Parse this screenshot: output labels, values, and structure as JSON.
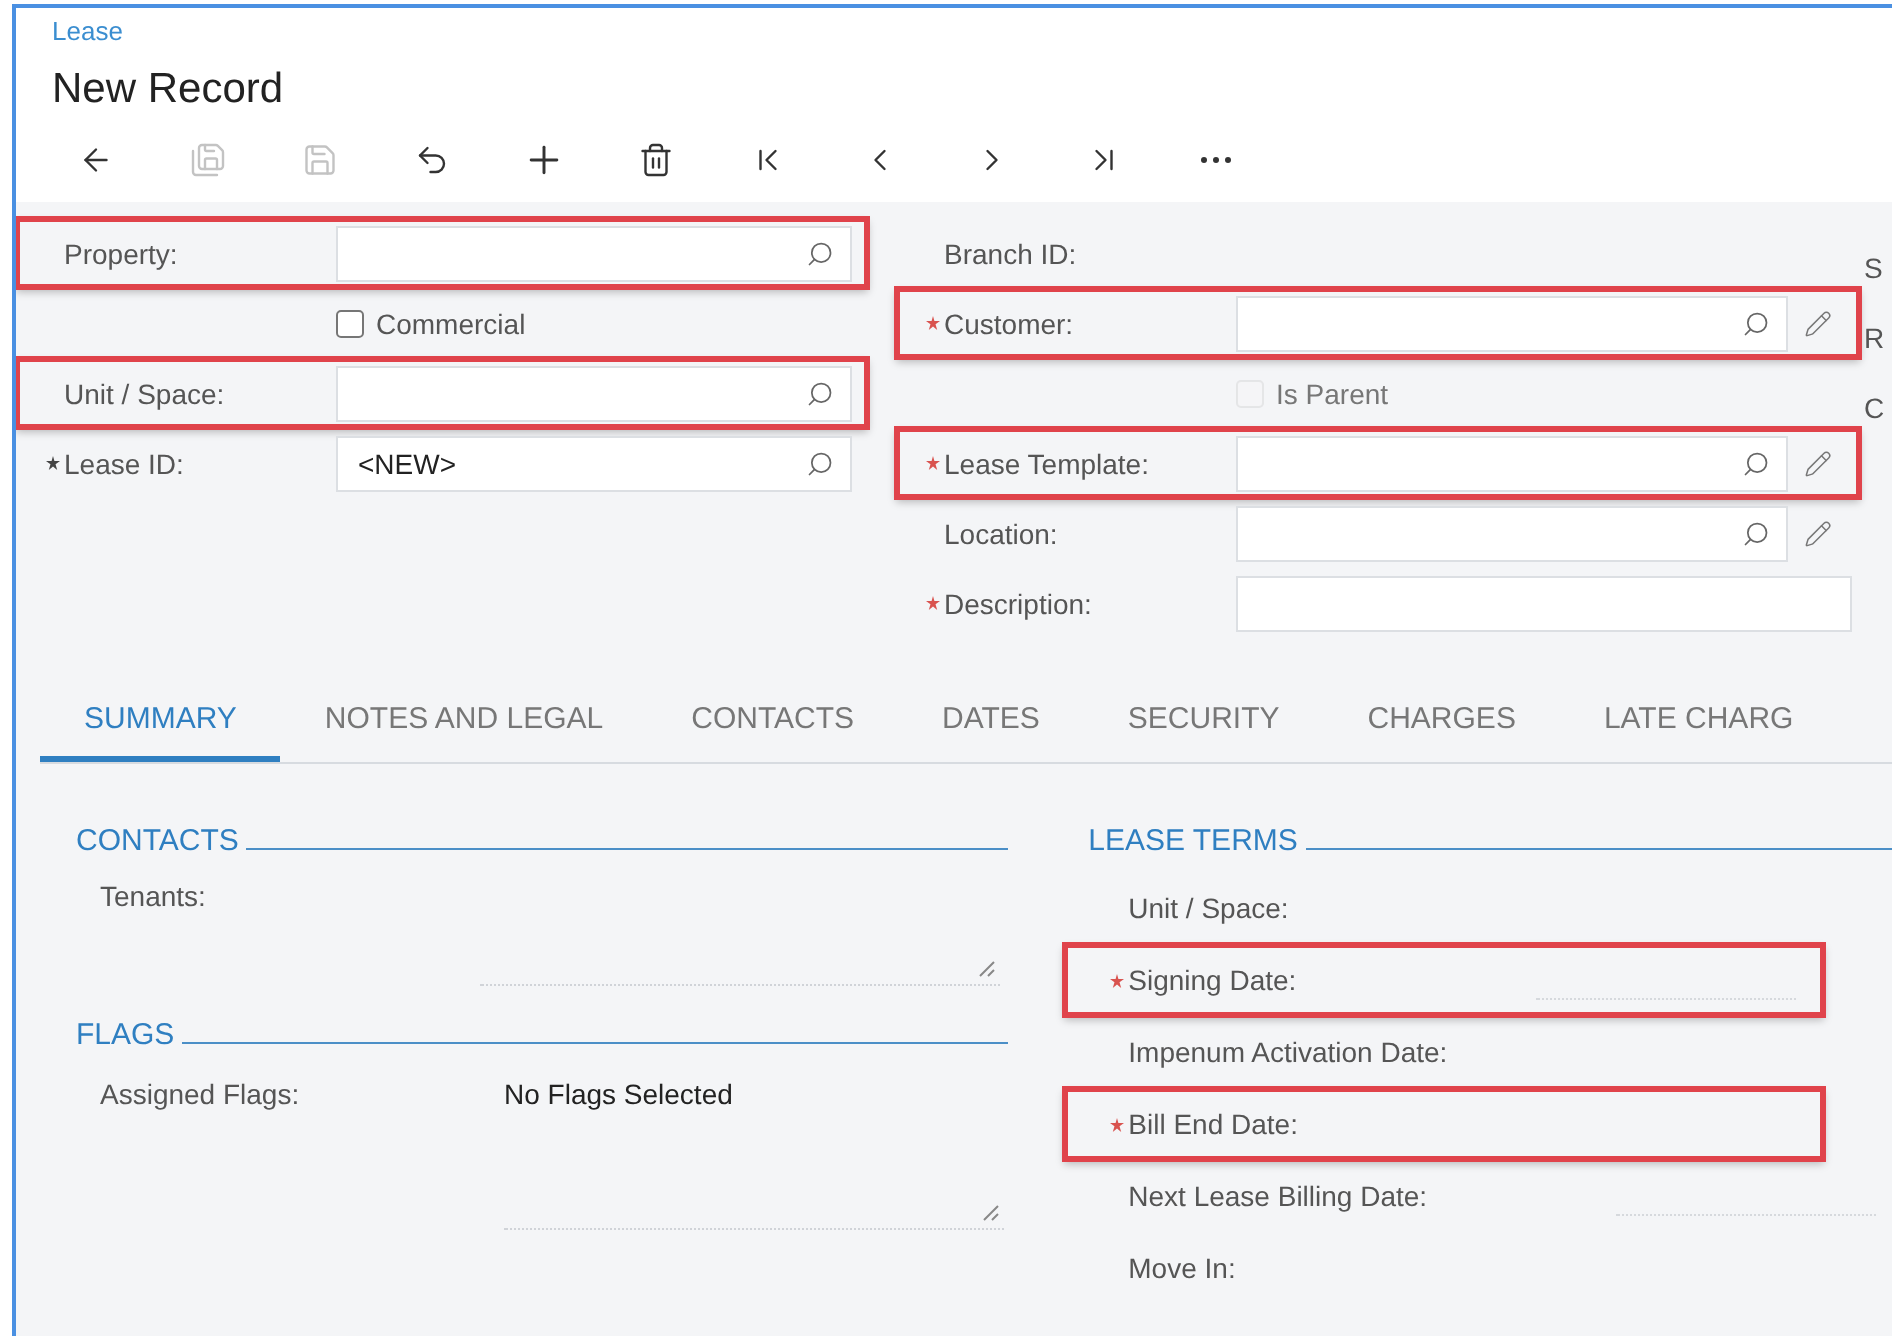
{
  "breadcrumb": "Lease",
  "title": "New Record",
  "toolbar": [
    {
      "kind": "back",
      "disabled": false
    },
    {
      "kind": "save-close",
      "disabled": true
    },
    {
      "kind": "save",
      "disabled": true
    },
    {
      "kind": "undo",
      "disabled": false
    },
    {
      "kind": "add",
      "disabled": false
    },
    {
      "kind": "delete",
      "disabled": false
    },
    {
      "kind": "first",
      "disabled": false
    },
    {
      "kind": "prev",
      "disabled": false
    },
    {
      "kind": "next",
      "disabled": false
    },
    {
      "kind": "last",
      "disabled": false
    },
    {
      "kind": "more",
      "disabled": false
    }
  ],
  "left_fields": [
    {
      "kind": "lookup",
      "label": "Property:",
      "required": false,
      "highlighted": true
    },
    {
      "kind": "checkbox",
      "label": "Commercial",
      "checked": false,
      "disabled": false
    },
    {
      "kind": "lookup",
      "label": "Unit / Space:",
      "required": false,
      "highlighted": true
    },
    {
      "kind": "lookup",
      "label": "Lease ID:",
      "required": true,
      "highlighted": false,
      "value": "<NEW>"
    }
  ],
  "right_fields": [
    {
      "kind": "label",
      "label": "Branch ID:",
      "required": false,
      "highlighted": false
    },
    {
      "kind": "lookup",
      "label": "Customer:",
      "required": true,
      "highlighted": true,
      "editable": true
    },
    {
      "kind": "checkbox",
      "label": "Is Parent",
      "checked": false,
      "disabled": true
    },
    {
      "kind": "lookup",
      "label": "Lease Template:",
      "required": true,
      "highlighted": true,
      "editable": true
    },
    {
      "kind": "lookup",
      "label": "Location:",
      "required": false,
      "highlighted": false,
      "editable": true
    },
    {
      "kind": "text",
      "label": "Description:",
      "required": true,
      "highlighted": false
    }
  ],
  "column_3_labels": [
    "S",
    "R",
    "C"
  ],
  "tabs": [
    {
      "label": "SUMMARY",
      "selected": true
    },
    {
      "label": "NOTES AND LEGAL",
      "selected": false
    },
    {
      "label": "CONTACTS",
      "selected": false
    },
    {
      "label": "DATES",
      "selected": false
    },
    {
      "label": "SECURITY",
      "selected": false
    },
    {
      "label": "CHARGES",
      "selected": false
    },
    {
      "label": "LATE CHARG",
      "selected": false
    }
  ],
  "contacts": {
    "title": "CONTACTS",
    "fields": [
      {
        "label": "Tenants:"
      }
    ]
  },
  "flags": {
    "title": "FLAGS",
    "fields": [
      {
        "label": "Assigned Flags:",
        "value": "No Flags Selected"
      }
    ]
  },
  "lease_terms": {
    "title": "LEASE TERMS",
    "fields": [
      {
        "kind": "label",
        "label": "Unit / Space:",
        "required": false,
        "highlighted": false
      },
      {
        "kind": "date",
        "label": "Signing Date:",
        "required": true,
        "highlighted": true
      },
      {
        "kind": "label",
        "label": "Impenum Activation Date:",
        "required": false,
        "highlighted": false
      },
      {
        "kind": "label",
        "label": "Bill End Date:",
        "required": true,
        "highlighted": true
      },
      {
        "kind": "date",
        "label": "Next Lease Billing Date:",
        "required": false,
        "highlighted": false
      },
      {
        "kind": "label",
        "label": "Move In:",
        "required": false,
        "highlighted": false
      }
    ]
  }
}
